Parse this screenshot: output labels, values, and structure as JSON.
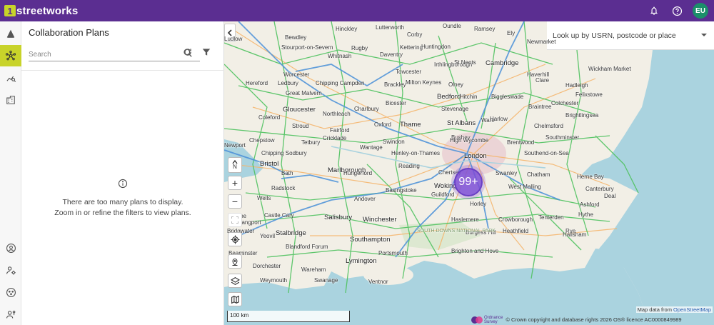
{
  "app": {
    "brand_mark": "1",
    "brand_text": "streetworks"
  },
  "topbar": {
    "icons": [
      "bell-icon",
      "help-icon"
    ],
    "avatar_initials": "EU"
  },
  "rail": {
    "items": [
      {
        "icon": "roadworks-icon",
        "active": false
      },
      {
        "icon": "collaboration-network-icon",
        "active": true
      },
      {
        "icon": "analytics-search-icon",
        "active": false
      },
      {
        "icon": "building-icon",
        "active": false
      },
      {
        "icon": "account-circle-icon",
        "active": false
      },
      {
        "icon": "user-settings-icon",
        "active": false
      },
      {
        "icon": "support-icon",
        "active": false
      },
      {
        "icon": "user-admin-icon",
        "active": false
      }
    ]
  },
  "panel": {
    "title": "Collaboration Plans",
    "search_placeholder": "Search",
    "empty_line1": "There are too many plans to display.",
    "empty_line2": "Zoom in or refine the filters to view plans."
  },
  "map": {
    "lookup_placeholder": "Look up by USRN, postcode or place",
    "compass_label": "N",
    "zoom_in": "+",
    "zoom_out": "−",
    "cluster_label": "99+",
    "scale_label": "100 km",
    "attribution_prefix": "Map data from",
    "attribution_link": "OpenStreetMap",
    "copyright": "© Crown copyright and database rights 2026 OS® licence AC0000849989",
    "os_logo_text1": "Ordnance",
    "os_logo_text2": "Survey",
    "places": [
      "Ludlow",
      "Bewdley",
      "Hinckley",
      "Lutterworth",
      "Corby",
      "Oundle",
      "Ramsey",
      "Ely",
      "Stourport-on-Severn",
      "Rugby",
      "Kettering",
      "Huntingdon",
      "Newmarket",
      "Worcester",
      "Whitnash",
      "Daventry",
      "Irthlingborough",
      "St Neots",
      "Cambridge",
      "Great Malvern",
      "Towcester",
      "Olney",
      "Bedford",
      "Haverhill",
      "Wickham Market",
      "Hereford",
      "Ledbury",
      "Chipping Campden",
      "Brackley",
      "Milton Keynes",
      "Biggleswade",
      "Clare",
      "Hadleigh",
      "Hitchin",
      "Felixstowe",
      "Gloucester",
      "Charlbury",
      "Bicester",
      "Stevenage",
      "Ware",
      "Braintree",
      "Colchester",
      "Northleach",
      "Harlow",
      "Brightlingsea",
      "Coleford",
      "Oxford",
      "Thame",
      "St Albans",
      "Chelmsford",
      "Stroud",
      "Fairford",
      "Bushey",
      "Southminster",
      "Chepstow",
      "Cricklade",
      "Wantage",
      "High Wycombe",
      "Brentwood",
      "Newport",
      "Tetbury",
      "Henley-on-Thames",
      "Southend-on-Sea",
      "Chipping Sodbury",
      "Swindon",
      "London",
      "Bristol",
      "Marlborough",
      "Reading",
      "Herne Bay",
      "Bath",
      "Chertsey",
      "Swanley",
      "Chatham",
      "Hungerford",
      "Basingstoke",
      "Woking",
      "Canterbury",
      "Radstock",
      "Deal",
      "Wells",
      "Guildford",
      "West Malling",
      "Frome",
      "Andover",
      "Ashford",
      "Castle Cary",
      "Salisbury",
      "Winchester",
      "Horley",
      "Haslemere",
      "Crowborough",
      "Tenterden",
      "Hythe",
      "Yeovil",
      "Stalbridge",
      "Southampton",
      "Burgess Hill",
      "Heathfield",
      "Rye",
      "Blandford Forum",
      "Portsmouth",
      "Brighton and Hove",
      "Beaminster",
      "Lymington",
      "Dorchester",
      "Wareham",
      "Weymouth",
      "Swanage",
      "Ventnor",
      "Hailsham",
      "SOUTH DOWNS NATIONAL PARK",
      "Langport",
      "Bridgwater"
    ]
  }
}
